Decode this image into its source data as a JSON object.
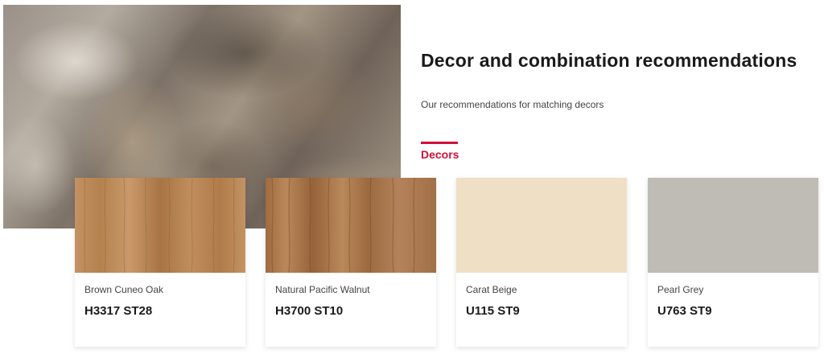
{
  "section": {
    "title": "Decor and combination recommendations",
    "subtitle": "Our recommendations for matching decors",
    "active_tab": "Decors"
  },
  "colors": {
    "accent": "#d0103a"
  },
  "cards": [
    {
      "name": "Brown Cuneo Oak",
      "code": "H3317 ST28",
      "swatch": "wood-light",
      "color": "#b98a5a"
    },
    {
      "name": "Natural Pacific Walnut",
      "code": "H3700 ST10",
      "swatch": "wood-walnut",
      "color": "#a9764a"
    },
    {
      "name": "Carat Beige",
      "code": "U115 ST9",
      "swatch": "solid",
      "color": "#efe0c5"
    },
    {
      "name": "Pearl Grey",
      "code": "U763 ST9",
      "swatch": "solid",
      "color": "#bfbbb5"
    }
  ]
}
